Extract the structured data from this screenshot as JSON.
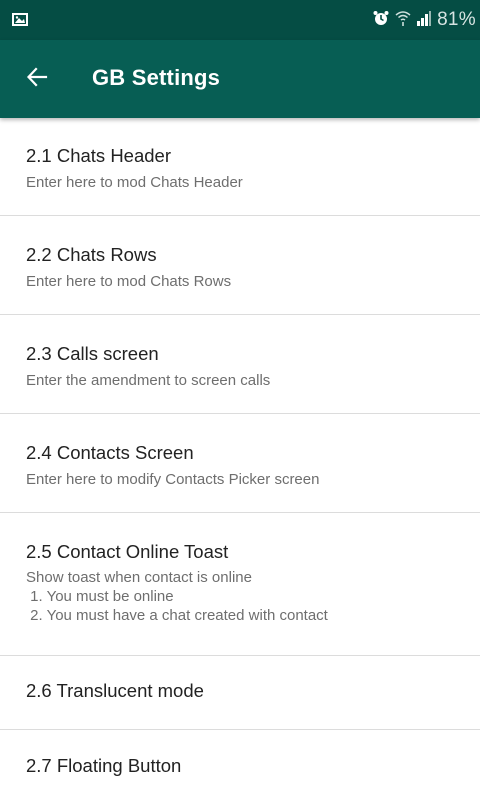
{
  "status_bar": {
    "battery_percent": "81%",
    "icons": [
      "image-notification-icon",
      "alarm-icon",
      "wifi-icon",
      "signal-icon"
    ]
  },
  "app_bar": {
    "title": "GB Settings",
    "back_icon": "arrow-left-icon"
  },
  "colors": {
    "status_bar": "#054d44",
    "app_bar": "#075e54",
    "divider": "#dcdcdc",
    "title_text": "#222222",
    "subtitle_text": "#6e6e6e"
  },
  "settings": [
    {
      "title": "2.1 Chats Header",
      "subtitle": "Enter here to mod Chats Header"
    },
    {
      "title": "2.2 Chats Rows",
      "subtitle": "Enter here to mod Chats Rows"
    },
    {
      "title": "2.3 Calls screen",
      "subtitle": "Enter the amendment to screen calls"
    },
    {
      "title": "2.4 Contacts Screen",
      "subtitle": "Enter here to modify Contacts Picker screen"
    },
    {
      "title": "2.5 Contact Online Toast",
      "subtitle": "Show toast when contact is online",
      "subtitle_line2": " 1. You must be online",
      "subtitle_line3": " 2. You must have a chat created with contact"
    },
    {
      "title": "2.6 Translucent mode"
    },
    {
      "title": "2.7 Floating Button"
    }
  ]
}
